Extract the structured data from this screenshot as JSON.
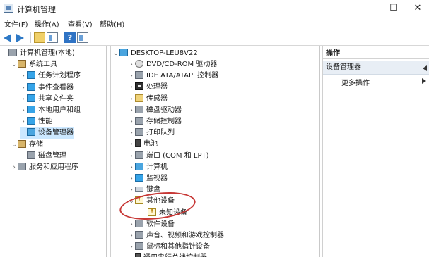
{
  "window": {
    "title": "计算机管理",
    "controls": {
      "minimize": "—",
      "maximize": "☐",
      "close": "✕"
    }
  },
  "menu": [
    "文件(F)",
    "操作(A)",
    "查看(V)",
    "帮助(H)"
  ],
  "toolbar": {
    "icons": [
      "back-arrow-icon",
      "forward-arrow-icon",
      "folder-up-icon",
      "show-panel-icon",
      "help-icon",
      "properties-icon"
    ],
    "help_glyph": "?"
  },
  "left_tree": [
    {
      "label": "计算机管理(本地)",
      "indent": 0,
      "chev": ""
    },
    {
      "label": "系统工具",
      "indent": 1,
      "chev": "⌄"
    },
    {
      "label": "任务计划程序",
      "indent": 2,
      "chev": "›"
    },
    {
      "label": "事件查看器",
      "indent": 2,
      "chev": "›"
    },
    {
      "label": "共享文件夹",
      "indent": 2,
      "chev": "›"
    },
    {
      "label": "本地用户和组",
      "indent": 2,
      "chev": "›"
    },
    {
      "label": "性能",
      "indent": 2,
      "chev": "›"
    },
    {
      "label": "设备管理器",
      "indent": 2,
      "chev": "",
      "selected": true
    },
    {
      "label": "存储",
      "indent": 1,
      "chev": "⌄"
    },
    {
      "label": "磁盘管理",
      "indent": 2,
      "chev": ""
    },
    {
      "label": "服务和应用程序",
      "indent": 1,
      "chev": "›"
    }
  ],
  "device_tree": {
    "root": "DESKTOP-LEU8V22",
    "items": [
      {
        "label": "DVD/CD-ROM 驱动器",
        "chev": "›",
        "icon": "dvd-drive-icon"
      },
      {
        "label": "IDE ATA/ATAPI 控制器",
        "chev": "›",
        "icon": "ide-controller-icon"
      },
      {
        "label": "处理器",
        "chev": "›",
        "icon": "processor-icon"
      },
      {
        "label": "传感器",
        "chev": "›",
        "icon": "sensor-icon"
      },
      {
        "label": "磁盘驱动器",
        "chev": "›",
        "icon": "disk-drive-icon"
      },
      {
        "label": "存储控制器",
        "chev": "›",
        "icon": "storage-controller-icon"
      },
      {
        "label": "打印队列",
        "chev": "›",
        "icon": "print-queue-icon"
      },
      {
        "label": "电池",
        "chev": "›",
        "icon": "battery-icon"
      },
      {
        "label": "端口 (COM 和 LPT)",
        "chev": "›",
        "icon": "port-icon"
      },
      {
        "label": "计算机",
        "chev": "›",
        "icon": "computer-icon"
      },
      {
        "label": "监视器",
        "chev": "›",
        "icon": "monitor-icon"
      },
      {
        "label": "键盘",
        "chev": "›",
        "icon": "keyboard-icon"
      },
      {
        "label": "其他设备",
        "chev": "⌄",
        "icon": "other-devices-icon"
      },
      {
        "label": "未知设备",
        "chev": "",
        "icon": "unknown-device-icon",
        "child": true
      },
      {
        "label": "软件设备",
        "chev": "›",
        "icon": "software-device-icon"
      },
      {
        "label": "声音、视频和游戏控制器",
        "chev": "›",
        "icon": "sound-controller-icon"
      },
      {
        "label": "鼠标和其他指针设备",
        "chev": "›",
        "icon": "mouse-icon"
      },
      {
        "label": "通用串行总线控制器",
        "chev": "›",
        "icon": "usb-controller-icon"
      }
    ]
  },
  "actions": {
    "header": "操作",
    "group": "设备管理器",
    "more": "更多操作"
  }
}
